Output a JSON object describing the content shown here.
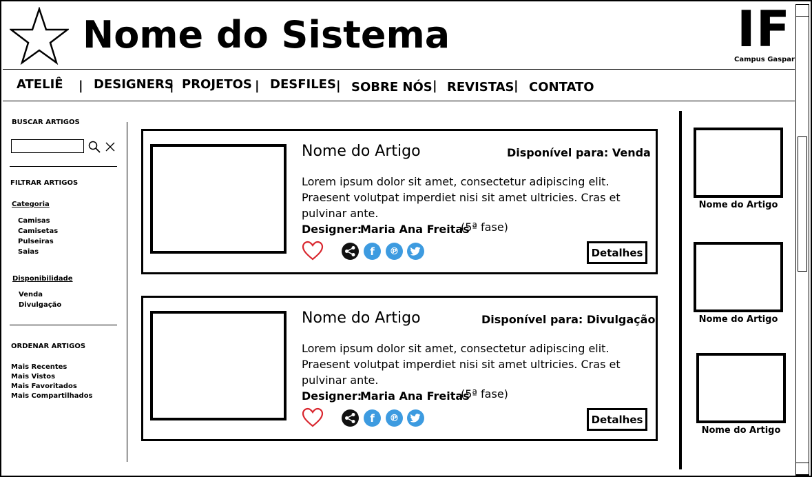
{
  "header": {
    "title": "Nome do Sistema",
    "institution_logo": "IF",
    "institution_campus": "Campus Gaspar"
  },
  "nav": {
    "items": [
      "ATELIÊ",
      "DESIGNERS",
      "PROJETOS",
      "DESFILES",
      "SOBRE NÓS",
      "REVISTAS",
      "CONTATO"
    ],
    "separator": "|"
  },
  "sidebar": {
    "search_heading": "BUSCAR ARTIGOS",
    "search_value": "",
    "filter_heading": "FILTRAR ARTIGOS",
    "category_label": "Categoria",
    "categories": [
      "Camisas",
      "Camisetas",
      "Pulseiras",
      "Saias"
    ],
    "availability_label": "Disponibilidade",
    "availability": [
      "Venda",
      "Divulgação"
    ],
    "sort_heading": "ORDENAR ARTIGOS",
    "sort_options": [
      "Mais Recentes",
      "Mais Vistos",
      "Mais Favoritados",
      "Mais Compartilhados"
    ]
  },
  "articles": [
    {
      "title": "Nome do Artigo",
      "availability": "Disponível para: Venda",
      "description": "Lorem ipsum dolor sit amet, consectetur adipiscing elit. Praesent volutpat imperdiet nisi sit amet ultricies. Cras et pulvinar ante.",
      "designer_label": "Designer:",
      "designer_name": "Maria Ana Freitas",
      "phase": "(5ª fase)",
      "details_label": "Detalhes"
    },
    {
      "title": "Nome do Artigo",
      "availability": "Disponível para: Divulgação",
      "description": "Lorem ipsum dolor sit amet, consectetur adipiscing elit. Praesent volutpat imperdiet nisi sit amet ultricies. Cras et pulvinar ante.",
      "designer_label": "Designer:",
      "designer_name": "Maria Ana Freitas",
      "phase": "(5ª fase)",
      "details_label": "Detalhes"
    }
  ],
  "related": [
    {
      "label": "Nome do Artigo"
    },
    {
      "label": "Nome do Artigo"
    },
    {
      "label": "Nome do Artigo"
    }
  ],
  "icons": {
    "logo": "star-icon",
    "search": "search-icon",
    "clear": "close-icon",
    "favorite": "heart-icon",
    "share": "share-icon",
    "facebook": "facebook-icon",
    "pinterest": "pinterest-icon",
    "twitter": "twitter-icon"
  },
  "colors": {
    "heart": "#d9262e",
    "social_blue": "#3d9be0",
    "share_dark": "#111111"
  }
}
